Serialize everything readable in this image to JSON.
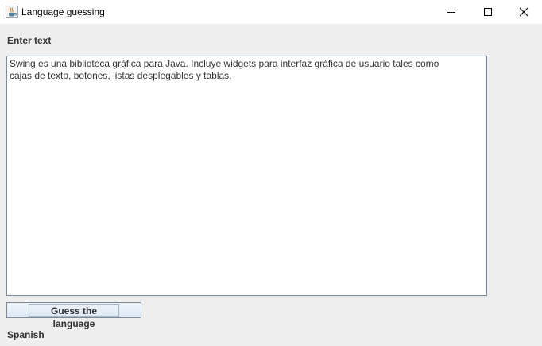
{
  "window": {
    "title": "Language guessing",
    "icon": "java-coffee-cup-icon",
    "controls": [
      "minimize-icon",
      "maximize-icon",
      "close-icon"
    ]
  },
  "form": {
    "prompt_label": "Enter text",
    "input_value": "Swing es una biblioteca gráfica para Java. Incluye widgets para interfaz gráfica de usuario tales como\ncajas de texto, botones, listas desplegables y tablas.",
    "guess_button_label": "Guess the language",
    "result_text": "Spanish"
  },
  "colors": {
    "window_background": "#eeeeee",
    "title_bar": "#ffffff",
    "text_area_border": "#7a8a99",
    "text_color": "#333333"
  }
}
